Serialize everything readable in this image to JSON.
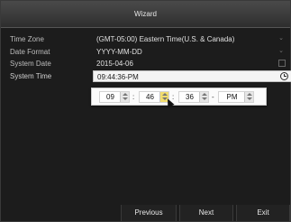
{
  "window": {
    "title": "Wizard"
  },
  "form": {
    "rows": [
      {
        "label": "Time Zone",
        "value": "(GMT-05:00) Eastern Time(U.S. & Canada)"
      },
      {
        "label": "Date Format",
        "value": "YYYY-MM-DD"
      },
      {
        "label": "System Date",
        "value": "2015-04-06"
      },
      {
        "label": "System Time",
        "value": "09:44:36-PM"
      }
    ]
  },
  "time_picker": {
    "hour": "09",
    "minute": "46",
    "second": "36",
    "ampm": "PM",
    "separator": ":",
    "separator2": "-"
  },
  "footer": {
    "previous_label": "Previous",
    "next_label": "Next",
    "exit_label": "Exit"
  },
  "icons": {
    "time_zone_arrow": "chevron-down-icon",
    "date_format_arrow": "chevron-down-icon",
    "system_date": "calendar-icon",
    "system_time": "clock-icon"
  }
}
